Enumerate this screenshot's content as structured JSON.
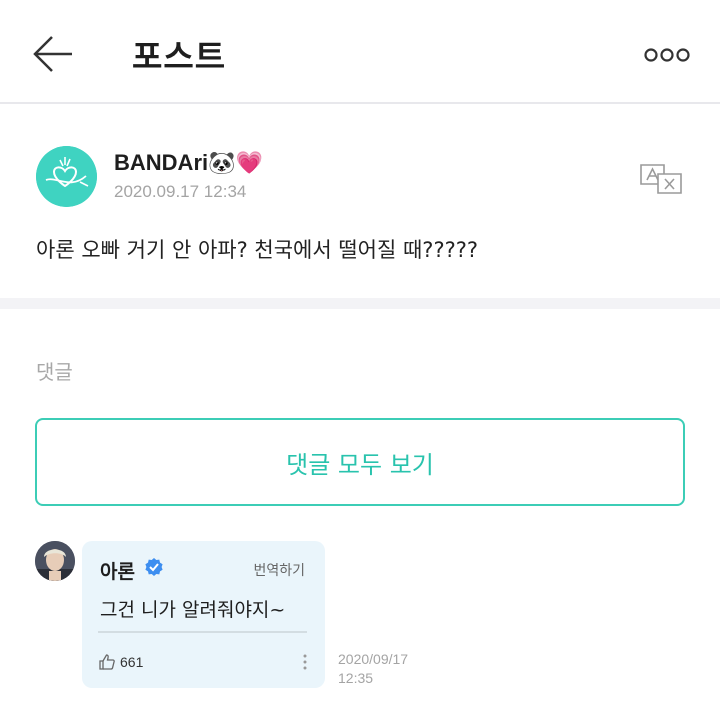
{
  "header": {
    "title": "포스트",
    "back_icon": "arrow-left-icon",
    "more_icon": "more-horizontal-icon"
  },
  "post": {
    "author": "BANDAri",
    "author_emoji": "🐼💗",
    "date": "2020.09.17 12:34",
    "body": "아론 오빠 거기 안 아파? 천국에서 떨어질 때?????",
    "translate_icon": "translate-icon",
    "avatar_color": "#3fd3c1"
  },
  "comments": {
    "label": "댓글",
    "view_all_label": "댓글 모두 보기",
    "items": [
      {
        "author": "아론",
        "translate_label": "번역하기",
        "text": "그건 니가 알려줘야지~",
        "likes": "661",
        "date_line1": "2020/09/17",
        "date_line2": "12:35"
      }
    ]
  },
  "colors": {
    "accent": "#29c3ad",
    "bubble_bg": "#eaf5fb",
    "verified": "#3d8ef0"
  }
}
